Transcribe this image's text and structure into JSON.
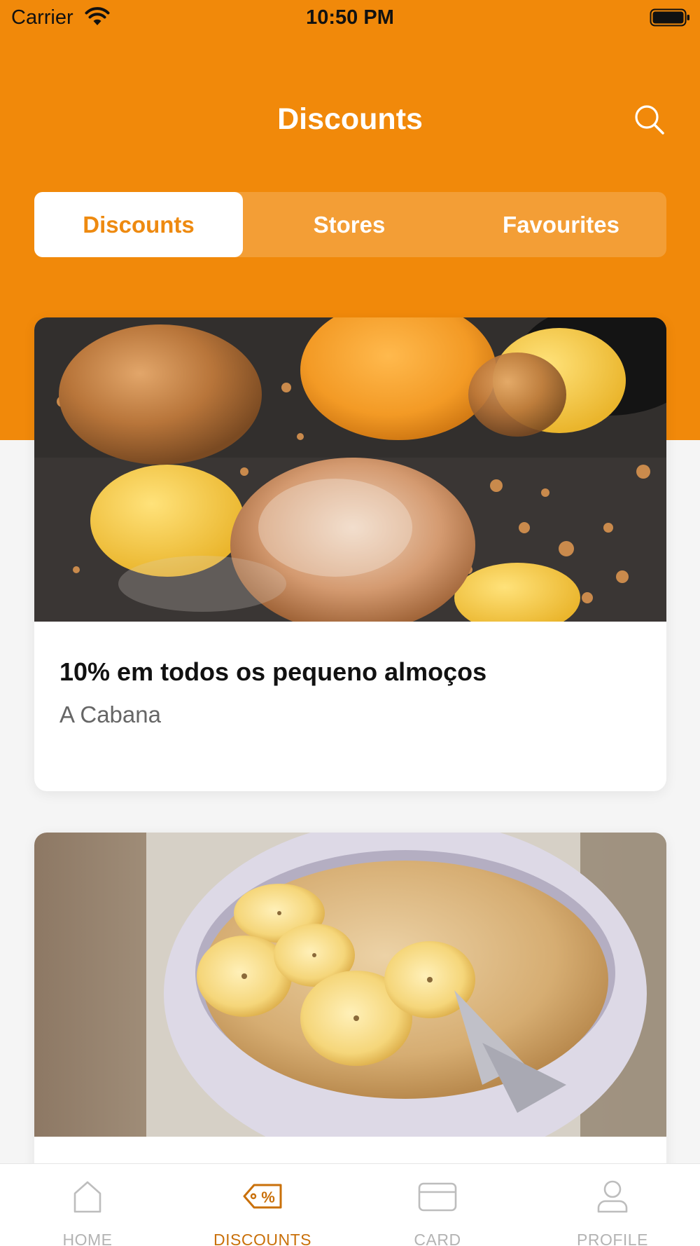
{
  "status_bar": {
    "carrier": "Carrier",
    "time": "10:50 PM"
  },
  "header": {
    "title": "Discounts",
    "search_icon": "search-icon"
  },
  "segments": [
    {
      "label": "Discounts",
      "active": true
    },
    {
      "label": "Stores",
      "active": false
    },
    {
      "label": "Favourites",
      "active": false
    }
  ],
  "cards": [
    {
      "title": "10% em todos os pequeno almoços",
      "store": "A Cabana",
      "image": "dessert-photo"
    },
    {
      "title": "",
      "store": "",
      "image": "porridge-photo"
    }
  ],
  "tab_bar": [
    {
      "label": "HOME",
      "icon": "home-icon",
      "active": false
    },
    {
      "label": "DISCOUNTS",
      "icon": "discount-tag-icon",
      "active": true
    },
    {
      "label": "CARD",
      "icon": "card-icon",
      "active": false
    },
    {
      "label": "PROFILE",
      "icon": "profile-icon",
      "active": false
    }
  ],
  "colors": {
    "accent": "#f1890a",
    "active_text": "#ee8a10",
    "inactive_tab": "#b3b3b3"
  }
}
